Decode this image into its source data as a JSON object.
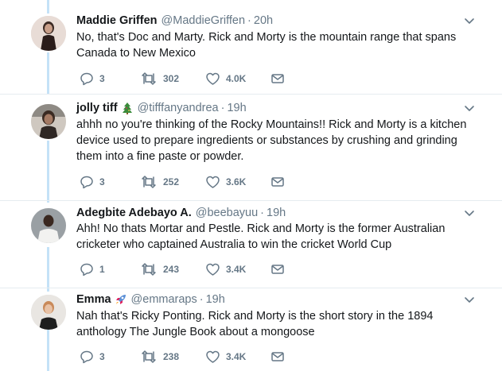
{
  "tweets": [
    {
      "name": "Maddie Griffen",
      "handle": "@MaddieGriffen",
      "separator": "·",
      "time": "20h",
      "text": "No, that's Doc and Marty. Rick and Morty is the mountain range that spans Canada to New Mexico",
      "replies": "3",
      "retweets": "302",
      "likes": "4.0K"
    },
    {
      "name": "jolly tiff",
      "emoji": "christmas-tree-icon",
      "handle": "@tifffanyandrea",
      "separator": "·",
      "time": "19h",
      "text": "ahhh no you're thinking of the Rocky Mountains!! Rick and Morty is a kitchen device used to prepare ingredients or substances by crushing and grinding them into a fine paste or powder.",
      "replies": "3",
      "retweets": "252",
      "likes": "3.6K"
    },
    {
      "name": "Adegbite Adebayo A.",
      "handle": "@beebayuu",
      "separator": "·",
      "time": "19h",
      "text": "Ahh! No thats Mortar and Pestle. Rick and Morty is the former  Australian cricketer who captained Australia to win the cricket World Cup",
      "replies": "1",
      "retweets": "243",
      "likes": "3.4K"
    },
    {
      "name": "Emma",
      "emoji": "rocket-icon",
      "handle": "@emmaraps",
      "separator": "·",
      "time": "19h",
      "text": "Nah that's Ricky Ponting. Rick and Morty is the short story in the 1894 anthology The Jungle Book about a mongoose",
      "replies": "3",
      "retweets": "238",
      "likes": "3.4K"
    }
  ],
  "colors": {
    "thread_line": "#c4e2f7",
    "muted_text": "#657786",
    "divider": "#e6ecf0"
  }
}
